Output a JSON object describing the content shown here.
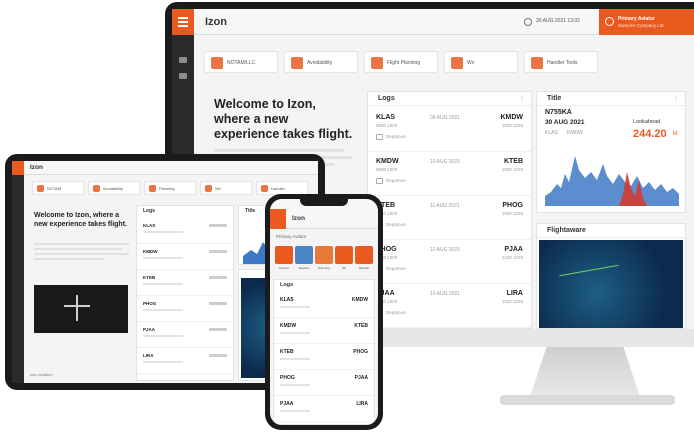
{
  "app": {
    "name": "Izon"
  },
  "monitor": {
    "date_chip": "30 AUG 2021 13:02",
    "user": {
      "line1": "Primary Aviator",
      "line2": "Samples Company Ltd"
    },
    "tiles": [
      {
        "label": "NOTAM/LLC",
        "icon": "plane-icon"
      },
      {
        "label": "Avoidability",
        "icon": "weather-cloud-icon"
      },
      {
        "label": "Flight Planning",
        "icon": "compass-icon"
      },
      {
        "label": "Wx",
        "icon": "calendar-icon"
      },
      {
        "label": "Handler Tools",
        "icon": "warning-icon"
      }
    ],
    "welcome_title": "Welcome to Izon, where a new experience takes flight.",
    "logs": {
      "title": "Logs",
      "entries": [
        {
          "dep": "KLAS",
          "dep_time": "0830 1900",
          "date": "09 AUG 2021",
          "arr": "KMDW",
          "arr_time": "1003 1225",
          "tag": "Departure"
        },
        {
          "dep": "KMDW",
          "dep_time": "0830 1900",
          "date": "10 AUG 2021",
          "arr": "KTEB",
          "arr_time": "1030 1225",
          "tag": "Departure"
        },
        {
          "dep": "KTEB",
          "dep_time": "0830 1900",
          "date": "11 AUG 2021",
          "arr": "PHOG",
          "arr_time": "1040 1225",
          "tag": "Departure"
        },
        {
          "dep": "PHOG",
          "dep_time": "0830 1900",
          "date": "12 AUG 2021",
          "arr": "PJAA",
          "arr_time": "1100 1225",
          "tag": "Departure"
        },
        {
          "dep": "PJAA",
          "dep_time": "0830 1900",
          "date": "13 AUG 2021",
          "arr": "LIRA",
          "arr_time": "1230 1225",
          "tag": "Departure"
        }
      ]
    },
    "title_panel": {
      "title": "Title",
      "tail": "N755KA",
      "date": "30 AUG 2021",
      "route_from": "KLAS",
      "route_to": "KMDW",
      "lookahead_label": "Lookahead",
      "value": "244.20",
      "unit": "kt"
    },
    "flightaware": {
      "title": "Flightaware"
    }
  },
  "tablet": {
    "welcome_title": "Welcome to Izon, where a new experience takes flight.",
    "logs_title": "Logs",
    "title_panel": "Title",
    "tiles": [
      {
        "label": "NOTAM",
        "icon": "plane-icon"
      },
      {
        "label": "Avoidability",
        "icon": "weather-cloud-icon"
      },
      {
        "label": "Planning",
        "icon": "compass-icon"
      },
      {
        "label": "Wx",
        "icon": "calendar-icon"
      },
      {
        "label": "Handler",
        "icon": "warning-icon"
      }
    ],
    "footer": "Izon Aviation",
    "rows": [
      "KLAS",
      "KMDW",
      "KTEB",
      "PHOG",
      "PJAA",
      "LIRA"
    ]
  },
  "phone": {
    "user_line": "Primary Aviator",
    "tiles": [
      {
        "label": "Notices",
        "icon": "plane-icon",
        "color": "#ea5a1f"
      },
      {
        "label": "Weather",
        "icon": "weather-cloud-icon",
        "color": "#4a86c5"
      },
      {
        "label": "Planning",
        "icon": "compass-icon",
        "color": "#e77a3a"
      },
      {
        "label": "Wx",
        "icon": "calendar-icon",
        "color": "#ea5a1f"
      },
      {
        "label": "Handler",
        "icon": "warning-icon",
        "color": "#ea5a1f"
      }
    ],
    "logs_title": "Logs",
    "rows": [
      {
        "dep": "KLAS",
        "arr": "KMDW"
      },
      {
        "dep": "KMDW",
        "arr": "KTEB"
      },
      {
        "dep": "KTEB",
        "arr": "PHOG"
      },
      {
        "dep": "PHOG",
        "arr": "PJAA"
      },
      {
        "dep": "PJAA",
        "arr": "LIRA"
      }
    ]
  },
  "colors": {
    "brand": "#ea5a1f",
    "chart_blue": "#3e79c7",
    "chart_red": "#d13b2e",
    "sidebar": "#2a2a2c"
  }
}
